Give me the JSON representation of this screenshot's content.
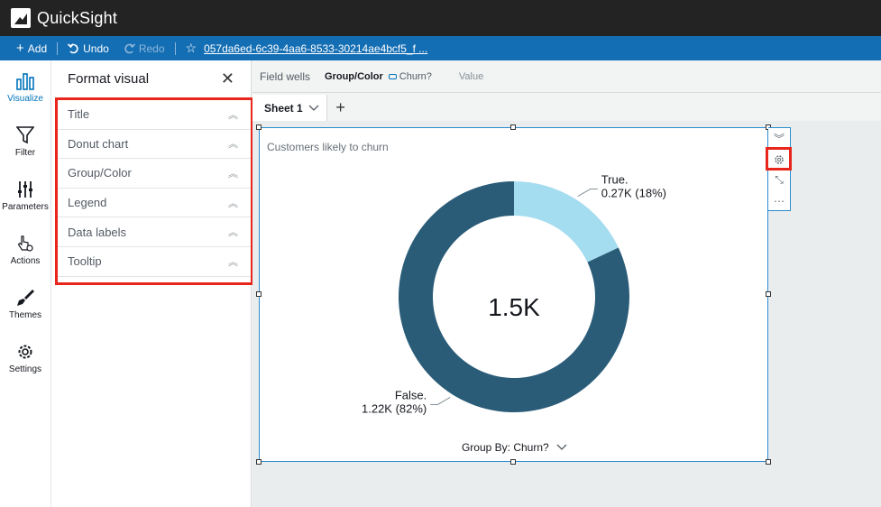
{
  "app": {
    "title": "QuickSight"
  },
  "toolbar": {
    "add": "Add",
    "undo": "Undo",
    "redo": "Redo",
    "file_name": "057da6ed-6c39-4aa6-8533-30214ae4bcf5_f ..."
  },
  "nav": [
    {
      "label": "Visualize",
      "icon": "bar-chart-icon"
    },
    {
      "label": "Filter",
      "icon": "funnel-icon"
    },
    {
      "label": "Parameters",
      "icon": "sliders-icon"
    },
    {
      "label": "Actions",
      "icon": "pointer-gear-icon"
    },
    {
      "label": "Themes",
      "icon": "brush-icon"
    },
    {
      "label": "Settings",
      "icon": "gear-icon"
    }
  ],
  "format_panel": {
    "title": "Format visual",
    "sections": [
      "Title",
      "Donut chart",
      "Group/Color",
      "Legend",
      "Data labels",
      "Tooltip"
    ]
  },
  "field_wells": {
    "title": "Field wells",
    "group_label": "Group/Color",
    "group_field": "Churn?",
    "value_label": "Value"
  },
  "tabs": [
    {
      "label": "Sheet 1"
    }
  ],
  "visual": {
    "title": "Customers likely to churn",
    "group_by": "Group By: Churn?"
  },
  "chart_data": {
    "type": "pie",
    "subtype": "donut",
    "title": "Customers likely to churn",
    "total_label": "1.5K",
    "slices": [
      {
        "name": "True.",
        "value": 0.27,
        "percent": 18,
        "label": "0.27K (18%)",
        "color": "#a4dcf0"
      },
      {
        "name": "False.",
        "value": 1.22,
        "percent": 82,
        "label": "1.22K (82%)",
        "color": "#2a5c78"
      }
    ]
  },
  "colors": {
    "accent": "#146eb4",
    "highlight": "#e8261b",
    "selection": "#2a8bd0"
  }
}
